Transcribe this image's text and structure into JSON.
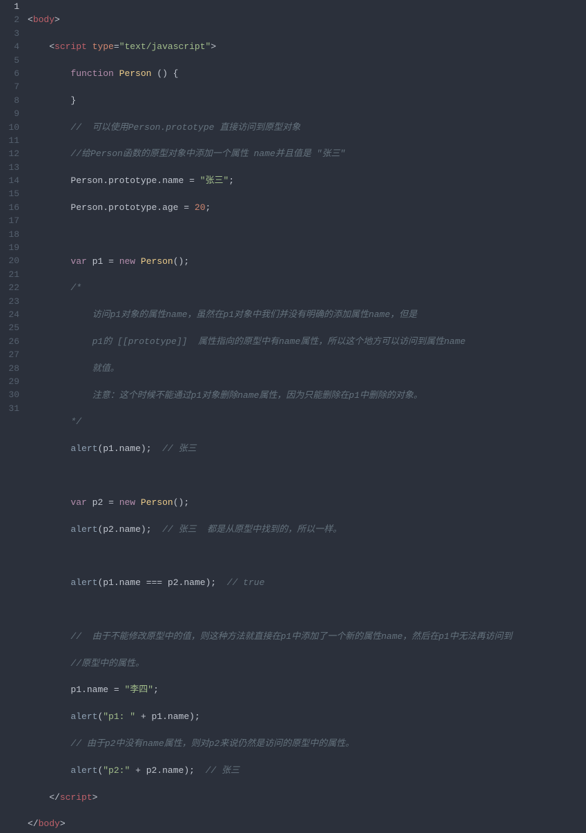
{
  "code": {
    "lines": [
      {
        "n": 1,
        "sel": true
      },
      {
        "n": 2
      },
      {
        "n": 3
      },
      {
        "n": 4
      },
      {
        "n": 5
      },
      {
        "n": 6
      },
      {
        "n": 7
      },
      {
        "n": 8
      },
      {
        "n": 9
      },
      {
        "n": 10
      },
      {
        "n": 11
      },
      {
        "n": 12
      },
      {
        "n": 13
      },
      {
        "n": 14
      },
      {
        "n": 15
      },
      {
        "n": 16
      },
      {
        "n": 17
      },
      {
        "n": 18
      },
      {
        "n": 19
      },
      {
        "n": 20
      },
      {
        "n": 21
      },
      {
        "n": 22
      },
      {
        "n": 23
      },
      {
        "n": 24
      },
      {
        "n": 25
      },
      {
        "n": 26
      },
      {
        "n": 27
      },
      {
        "n": 28
      },
      {
        "n": 29
      },
      {
        "n": 30
      },
      {
        "n": 31
      }
    ],
    "tokens": {
      "body_tag": "body",
      "script_tag": "script",
      "type_attr": "type",
      "type_val": "\"text/javascript\"",
      "kw_function": "function",
      "cls_person": "Person",
      "kw_var": "var",
      "kw_new": "new",
      "fn_alert": "alert",
      "var_p1": "p1",
      "var_p2": "p2",
      "prop_prototype": "prototype",
      "prop_name": "name",
      "prop_age": "age",
      "str_zhangsan": "\"张三\"",
      "str_lisi": "\"李四\"",
      "str_p1col": "\"p1: \"",
      "str_p2col": "\"p2:\"",
      "num_20": "20",
      "bool_true": "true",
      "cmt_l5": "//  可以使用Person.prototype 直接访问到原型对象",
      "cmt_l6": "//给Person函数的原型对象中添加一个属性 name并且值是 \"张三\"",
      "cmt_l11": "/*",
      "cmt_l12": "    访问p1对象的属性name，虽然在p1对象中我们并没有明确的添加属性name，但是",
      "cmt_l13": "    p1的 [[prototype]]  属性指向的原型中有name属性，所以这个地方可以访问到属性name",
      "cmt_l14": "    就值。",
      "cmt_l15": "    注意：这个时候不能通过p1对象删除name属性，因为只能删除在p1中删除的对象。",
      "cmt_l16": "*/",
      "cmt_l17": "// 张三",
      "cmt_l20": "// 张三  都是从原型中找到的，所以一样。",
      "cmt_l22": "// true",
      "cmt_l24": "//  由于不能修改原型中的值，则这种方法就直接在p1中添加了一个新的属性name，然后在p1中无法再访问到",
      "cmt_l25": "//原型中的属性。",
      "cmt_l28": "// 由于p2中没有name属性，则对p2来说仍然是访问的原型中的属性。",
      "cmt_l29": "// 张三"
    }
  }
}
